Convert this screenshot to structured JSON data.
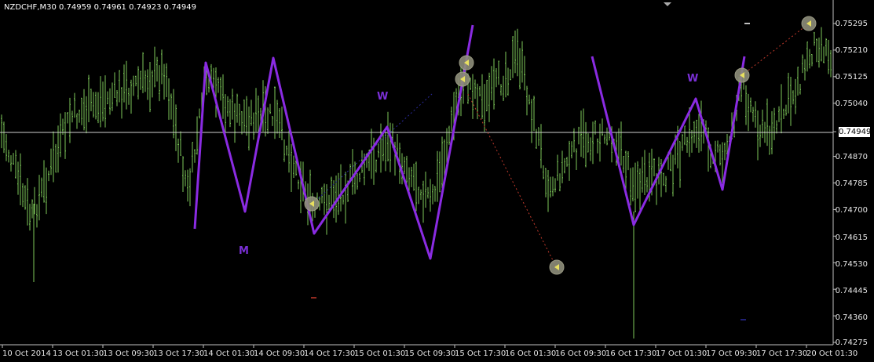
{
  "header": {
    "symbol": "NZDCHF,M30",
    "open": "0.74959",
    "high": "0.74961",
    "low": "0.74923",
    "close": "0.74949"
  },
  "current_price": "0.74949",
  "y_axis": {
    "ticks": [
      "0.75295",
      "0.75210",
      "0.75125",
      "0.75040",
      "0.74949",
      "0.74870",
      "0.74785",
      "0.74700",
      "0.74615",
      "0.74530",
      "0.74445",
      "0.74360",
      "0.74275"
    ]
  },
  "x_axis": {
    "ticks": [
      "10 Oct 2014",
      "13 Oct 01:30",
      "13 Oct 09:30",
      "13 Oct 17:30",
      "14 Oct 01:30",
      "14 Oct 09:30",
      "14 Oct 17:30",
      "15 Oct 01:30",
      "15 Oct 09:30",
      "15 Oct 17:30",
      "16 Oct 01:30",
      "16 Oct 09:30",
      "16 Oct 17:30",
      "17 Oct 01:30",
      "17 Oct 09:30",
      "17 Oct 17:30",
      "20 Oct 01:30"
    ]
  },
  "pattern_labels": [
    "M",
    "W",
    "W"
  ],
  "colors": {
    "background": "#000000",
    "bars": "#7ec95a",
    "zigzag": "#8a2be2",
    "dotted_line": "#c0392b",
    "axis_text": "#e6e6e6"
  },
  "chart_data": {
    "type": "line",
    "title": "",
    "xlabel": "",
    "ylabel": "",
    "ylim": [
      0.74275,
      0.75295
    ],
    "series": [
      {
        "values": [
          0.7466,
          0.7517,
          0.7472,
          0.7518,
          0.7464,
          0.7495,
          0.7456,
          0.753
        ]
      },
      {
        "values": [
          0.7518,
          0.7456,
          0.7518,
          0.7477,
          0.7506,
          0.7478,
          0.7519
        ]
      }
    ]
  }
}
